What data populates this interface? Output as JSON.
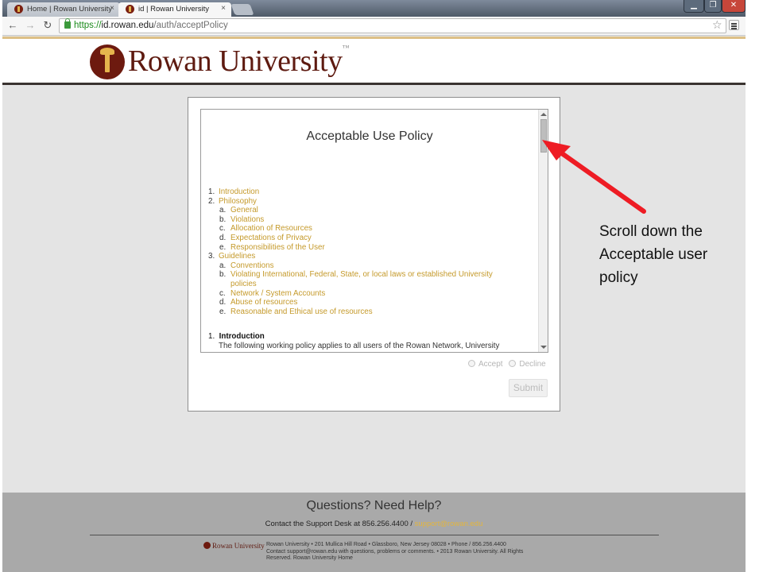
{
  "browser": {
    "tabs": [
      {
        "label": "Home | Rowan University",
        "close": "×"
      },
      {
        "label": "id | Rowan University",
        "close": "×"
      }
    ],
    "address": {
      "scheme": "https://",
      "host": "id.rowan.edu",
      "path": "/auth/acceptPolicy"
    },
    "window_controls": {
      "minimize": "▁",
      "restore": "❐",
      "close": "✕"
    },
    "nav": {
      "back": "←",
      "forward": "→",
      "reload": "↻",
      "star": "☆"
    }
  },
  "header": {
    "logo_text": "Rowan University",
    "trademark": "™"
  },
  "policy": {
    "title": "Acceptable Use Policy",
    "toc": [
      {
        "num": "1.",
        "label": "Introduction",
        "indent": 0
      },
      {
        "num": "2.",
        "label": "Philosophy",
        "indent": 0
      },
      {
        "num": "a.",
        "label": "General",
        "indent": 1
      },
      {
        "num": "b.",
        "label": "Violations",
        "indent": 1
      },
      {
        "num": "c.",
        "label": "Allocation of Resources",
        "indent": 1
      },
      {
        "num": "d.",
        "label": "Expectations of Privacy",
        "indent": 1
      },
      {
        "num": "e.",
        "label": "Responsibilities of the User",
        "indent": 1
      },
      {
        "num": "3.",
        "label": "Guidelines",
        "indent": 0
      },
      {
        "num": "a.",
        "label": "Conventions",
        "indent": 1
      },
      {
        "num": "b.",
        "label": "Violating International, Federal, State, or local laws or established University policies",
        "indent": 1
      },
      {
        "num": "c.",
        "label": "Network / System Accounts",
        "indent": 1
      },
      {
        "num": "d.",
        "label": "Abuse of resources",
        "indent": 1
      },
      {
        "num": "e.",
        "label": "Reasonable and Ethical use of resources",
        "indent": 1
      }
    ],
    "intro_num": "1.",
    "intro_heading": "Introduction",
    "intro_text": "The following working policy applies to all users of the Rowan Network, University"
  },
  "form": {
    "accept_label": "Accept",
    "decline_label": "Decline",
    "submit_label": "Submit"
  },
  "footer": {
    "title": "Questions? Need Help?",
    "contact_prefix": "Contact the Support Desk at 856.256.4400 / ",
    "email": "support@rowan.edu",
    "logo_text": "Rowan University",
    "address": "Rowan University • 201 Mullica Hill Road • Glassboro, New Jersey 08028 • Phone / 856.256.4400",
    "address2": "Contact support@rowan.edu with questions, problems or comments. • 2013 Rowan University. All Rights Reserved. Rowan University Home"
  },
  "annotation": {
    "text": "Scroll down the Acceptable user policy"
  },
  "colors": {
    "brand": "#6d1a0f",
    "gold_link": "#c59a2b",
    "arrow": "#ee1c24"
  }
}
